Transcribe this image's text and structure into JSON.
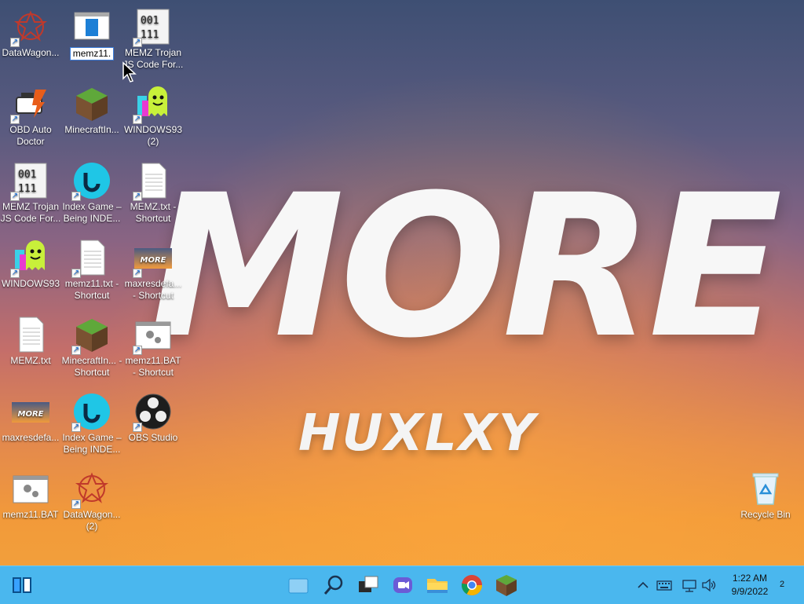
{
  "wallpaper": {
    "title": "MORE",
    "subtitle": "HUXLXY"
  },
  "desktop_icons": [
    {
      "label": "DataWagon...",
      "icon": "datawagon-icon"
    },
    {
      "label": "memz11.",
      "icon": "window-app-icon"
    },
    {
      "label": "MEMZ Trojan JS Code For...",
      "icon": "binary-file-icon"
    },
    {
      "label": "OBD Auto Doctor",
      "icon": "car-engine-icon"
    },
    {
      "label": "MinecraftIn...",
      "icon": "minecraft-block-icon"
    },
    {
      "label": "WINDOWS93 (2)",
      "icon": "windows93-icon"
    },
    {
      "label": "MEMZ Trojan JS Code For...",
      "icon": "binary-file-icon"
    },
    {
      "label": "Index Game – Being INDE...",
      "icon": "index-game-icon"
    },
    {
      "label": "MEMZ.txt - Shortcut",
      "icon": "text-file-icon"
    },
    {
      "label": "WINDOWS93",
      "icon": "windows93-icon"
    },
    {
      "label": "memz11.txt - Shortcut",
      "icon": "text-file-icon"
    },
    {
      "label": "maxresdefa... - Shortcut",
      "icon": "image-thumbnail-icon"
    },
    {
      "label": "MEMZ.txt",
      "icon": "text-file-icon"
    },
    {
      "label": "MinecraftIn... - Shortcut",
      "icon": "minecraft-block-icon"
    },
    {
      "label": "memz11.BAT - Shortcut",
      "icon": "batch-file-icon"
    },
    {
      "label": "maxresdefa...",
      "icon": "image-thumbnail-icon"
    },
    {
      "label": "Index Game – Being INDE...",
      "icon": "index-game-icon"
    },
    {
      "label": "OBS Studio",
      "icon": "obs-studio-icon"
    },
    {
      "label": "memz11.BAT",
      "icon": "batch-file-icon"
    },
    {
      "label": "DataWagon... (2)",
      "icon": "datawagon-icon"
    },
    {
      "label": "Recycle Bin",
      "icon": "recycle-bin-icon"
    }
  ],
  "thumbnail_text": "MORE",
  "taskbar": {
    "pinned": [
      "start-icon",
      "widgets-icon",
      "search-icon",
      "task-view-icon",
      "chat-icon",
      "file-explorer-icon",
      "chrome-icon",
      "minecraft-icon"
    ],
    "tray": [
      "show-hidden-icons-chevron",
      "keyboard-icon",
      "network-icon",
      "volume-icon"
    ],
    "time": "1:22 AM",
    "date": "9/9/2022",
    "notification_count": "2"
  },
  "colors": {
    "taskbar": "#4ab7ee",
    "selection_border": "#3b7ddb"
  }
}
